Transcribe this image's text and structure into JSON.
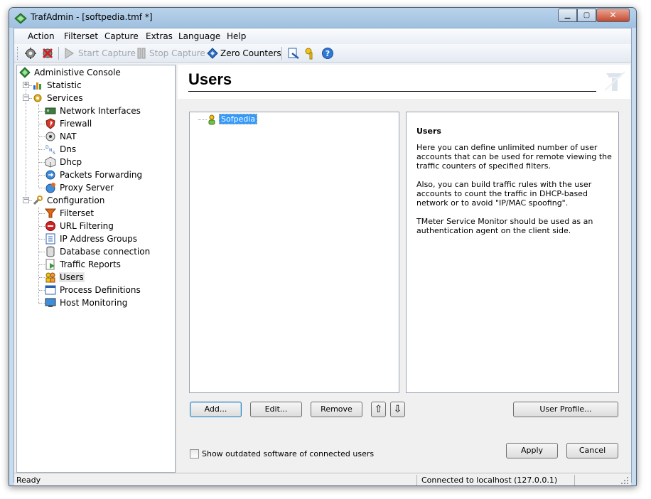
{
  "window": {
    "title": "TrafAdmin - [softpedia.tmf *]",
    "controls": {
      "minimize": "▁",
      "maximize": "▢",
      "close": "✕"
    }
  },
  "menu": [
    "Action",
    "Filterset",
    "Capture",
    "Extras",
    "Language",
    "Help"
  ],
  "toolbar": {
    "start_capture": "Start Capture",
    "stop_capture": "Stop Capture",
    "zero_counters": "Zero Counters"
  },
  "tree": {
    "root": "Administive Console",
    "statistic": "Statistic",
    "services": "Services",
    "service_items": [
      "Network Interfaces",
      "Firewall",
      "NAT",
      "Dns",
      "Dhcp",
      "Packets Forwarding",
      "Proxy Server"
    ],
    "configuration": "Configuration",
    "configuration_items": [
      "Filterset",
      "URL Filtering",
      "IP Address Groups",
      "Database connection",
      "Traffic Reports",
      "Users",
      "Process Definitions",
      "Host Monitoring"
    ],
    "selected": "Users"
  },
  "page": {
    "title": "Users",
    "users": [
      "Sofpedia"
    ],
    "info_title": "Users",
    "info_paragraphs": [
      "Here you can define unlimited number of user accounts that can be used for remote viewing the traffic counters of specified filters.",
      "Also, you can build traffic rules with the user accounts to count the traffic in DHCP-based network or to avoid \"IP/MAC spoofing\".",
      "TMeter Service Monitor should be used as an authentication agent on the client side."
    ],
    "buttons": {
      "add": "Add...",
      "edit": "Edit...",
      "remove": "Remove",
      "move_up": "⇧",
      "move_down": "⇩",
      "user_profile": "User Profile...",
      "apply": "Apply",
      "cancel": "Cancel"
    },
    "checkbox_label": "Show outdated software of connected users"
  },
  "status": {
    "left": "Ready",
    "right": "Connected to localhost (127.0.0.1)"
  },
  "colors": {
    "title_bar": "#b9d2ea",
    "selection": "#3399ff",
    "window_bg": "#f0f0f0"
  }
}
